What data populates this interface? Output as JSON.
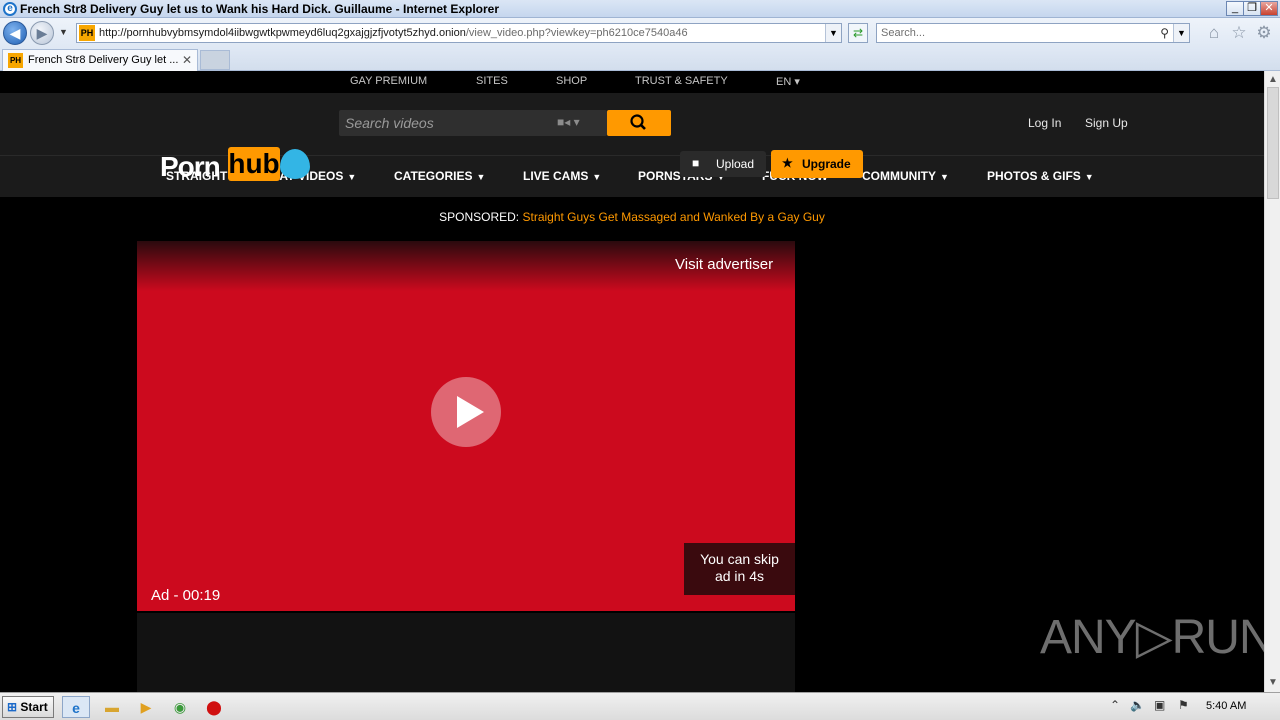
{
  "window": {
    "title": "French Str8 Delivery Guy let us to Wank his Hard Dick. Guillaume - Internet Explorer",
    "minimize": "_",
    "restore": "❐",
    "close": "✕"
  },
  "addressbar": {
    "favicon": "PH",
    "url_host": "http://pornhubvybmsymdol4iibwgwtkpwmeyd6luq2gxajgjzfjvotyt5zhyd.onion",
    "url_path": "/view_video.php?viewkey=ph6210ce7540a46",
    "search_placeholder": "Search..."
  },
  "tabs": [
    {
      "label": "French Str8 Delivery Guy let ...",
      "favicon": "PH"
    }
  ],
  "site": {
    "topnav": [
      "GAY PREMIUM",
      "SITES",
      "SHOP",
      "TRUST & SAFETY",
      "EN ▾"
    ],
    "search_placeholder": "Search videos",
    "login": "Log In",
    "signup": "Sign Up",
    "logo_porn": "Porn",
    "logo_hub": "hub",
    "upload": "Upload",
    "upgrade": "Upgrade",
    "mainnav": [
      "STRAIGHT",
      "GAY VIDEOS",
      "CATEGORIES",
      "LIVE CAMS",
      "PORNSTARS",
      "FUCK NOW",
      "COMMUNITY",
      "PHOTOS & GIFS"
    ],
    "sponsored_label": "SPONSORED:",
    "sponsored_link": "Straight Guys Get Massaged and Wanked By a Gay Guy"
  },
  "player": {
    "visit_advertiser": "Visit advertiser",
    "ad_time": "Ad - 00:19",
    "skip_line1": "You can skip",
    "skip_line2": "ad in 4s"
  },
  "watermark": "ANY▷RUN",
  "taskbar": {
    "start": "Start",
    "clock": "5:40 AM"
  }
}
